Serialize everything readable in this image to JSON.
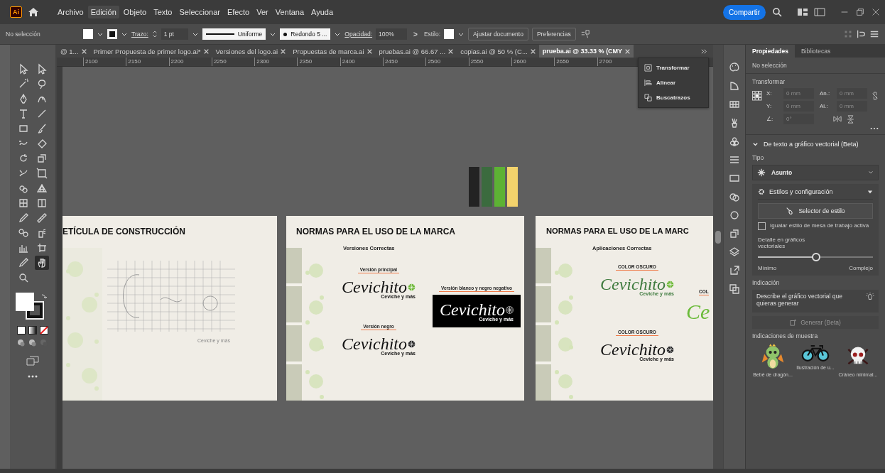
{
  "app": {
    "logo": "Ai",
    "menu": [
      {
        "label": "Archivo",
        "selected": false
      },
      {
        "label": "Edición",
        "selected": true
      },
      {
        "label": "Objeto",
        "selected": false
      },
      {
        "label": "Texto",
        "selected": false
      },
      {
        "label": "Seleccionar",
        "selected": false
      },
      {
        "label": "Efecto",
        "selected": false
      },
      {
        "label": "Ver",
        "selected": false
      },
      {
        "label": "Ventana",
        "selected": false
      },
      {
        "label": "Ayuda",
        "selected": false
      }
    ],
    "share_button": "Compartir"
  },
  "control_bar": {
    "selection": "No selección",
    "stroke_label": "Trazo:",
    "stroke_weight": "1 pt",
    "stroke_profile": "Uniforme",
    "brush": "Redondo 5 ...",
    "opacity_label": "Opacidad:",
    "opacity": "100%",
    "more": ">",
    "style_label": "Estilo:",
    "buttons": [
      "Ajustar documento",
      "Preferencias"
    ]
  },
  "document_tabs": [
    {
      "label": "@ 1...",
      "selected": false
    },
    {
      "label": "Primer Propuesta de primer logo.ai*",
      "selected": false
    },
    {
      "label": "Versiones del logo.ai",
      "selected": false
    },
    {
      "label": "Propuestas de marca.ai",
      "selected": false
    },
    {
      "label": "pruebas.ai @ 66.67 ...",
      "selected": false
    },
    {
      "label": "copias.ai @ 50 % (C...",
      "selected": false
    },
    {
      "label": "prueba.ai @ 33.33 % (CMY",
      "selected": true
    }
  ],
  "ruler": [
    "2100",
    "2150",
    "2200",
    "2250",
    "2300",
    "2350",
    "2400",
    "2450",
    "2500",
    "2550",
    "2600",
    "2650",
    "2700"
  ],
  "floating_panel": [
    "Transformar",
    "Alinear",
    "Buscatrazos"
  ],
  "swatches": [
    {
      "color": "#232323"
    },
    {
      "color": "#3b6b3e"
    },
    {
      "color": "#5db234"
    },
    {
      "color": "#f3d36c"
    }
  ],
  "artboards": [
    {
      "kind": "construction",
      "title": "ETÍCULA DE CONSTRUCCIÓN",
      "tagline": "Ceviche y más"
    },
    {
      "kind": "versions",
      "title": "NORMAS PARA EL USO DE LA MARCA",
      "subtitle": "Versiones Correctas",
      "logos": [
        {
          "label": "Versión principal",
          "kind": "primary",
          "wordmark": "Cevichito",
          "tagline": "Ceviche y más"
        },
        {
          "label": "Versión blanco y negro negativo",
          "kind": "negative",
          "wordmark": "Cevichito",
          "tagline": "Ceviche y más"
        },
        {
          "label": "Versión negro",
          "kind": "black",
          "wordmark": "Cevichito",
          "tagline": "Ceviche y más"
        }
      ]
    },
    {
      "kind": "applications",
      "title": "NORMAS PARA EL USO DE LA MARC",
      "subtitle": "Aplicaciones Correctas",
      "logos": [
        {
          "label": "COLOR OSCURO",
          "kind": "green",
          "wordmark": "Cevichito",
          "tagline": "Ceviche y más"
        },
        {
          "label": "COLOR OSCURO",
          "kind": "black",
          "wordmark": "Cevichito",
          "tagline": "Ceviche y más"
        }
      ],
      "partial_label": "COL",
      "partial_wordmark": "Ce"
    }
  ],
  "toolbar": {
    "tools": [
      {
        "selected": false
      },
      {
        "selected": false
      },
      {
        "selected": false
      },
      {
        "selected": false
      },
      {
        "selected": false
      },
      {
        "selected": false
      },
      {
        "selected": false
      },
      {
        "selected": false
      },
      {
        "selected": false
      },
      {
        "selected": false
      },
      {
        "selected": false
      },
      {
        "selected": false
      },
      {
        "selected": false
      },
      {
        "selected": false
      },
      {
        "selected": false
      },
      {
        "selected": false
      },
      {
        "selected": false
      },
      {
        "selected": false
      },
      {
        "selected": false
      },
      {
        "selected": false
      },
      {
        "selected": false
      },
      {
        "selected": false
      },
      {
        "selected": false
      },
      {
        "selected": false
      },
      {
        "selected": false
      },
      {
        "selected": false
      },
      {
        "selected": false
      },
      {
        "selected": true
      },
      {
        "selected": false
      }
    ]
  },
  "properties_panel": {
    "tabs": [
      {
        "label": "Propiedades",
        "selected": true
      },
      {
        "label": "Bibliotecas",
        "selected": false
      }
    ],
    "selection": "No selección",
    "transform": {
      "title": "Transformar",
      "fields": [
        {
          "label": "X:",
          "value": "0 mm",
          "disabled": true
        },
        {
          "label": "An.:",
          "value": "0 mm",
          "disabled": true
        },
        {
          "label": "Y:",
          "value": "0 mm",
          "disabled": true
        },
        {
          "label": "Al.:",
          "value": "0 mm",
          "disabled": true
        }
      ],
      "angle": {
        "label": "∠:",
        "value": "0°",
        "disabled": true
      }
    },
    "generator": {
      "title": "De texto a gráfico vectorial (Beta)",
      "expanded": true,
      "type_label": "Tipo",
      "type_value": "Asunto",
      "styles": {
        "title": "Estilos y configuración",
        "expanded": true,
        "style_button": "Selector de estilo",
        "match": {
          "label": "Igualar estilo de mesa de trabajo activa",
          "checked": false
        },
        "detail": {
          "label": "Detalle en gráficos vectoriales",
          "level": 0.5,
          "min": "Mínimo",
          "max": "Complejo"
        }
      },
      "prompt_label": "Indicación",
      "prompt": {
        "placeholder": "Describe el gráfico vectorial que quieras generar"
      },
      "generate": {
        "label": "Generar (Beta)",
        "disabled": true
      },
      "samples_label": "Indicaciones de muestra",
      "samples": [
        {
          "kind": "dragon",
          "label": "Bebé de dragón..."
        },
        {
          "kind": "bicycle",
          "label": "Ilustración de u..."
        },
        {
          "kind": "skull",
          "label": "Cráneo minimal..."
        }
      ]
    }
  }
}
